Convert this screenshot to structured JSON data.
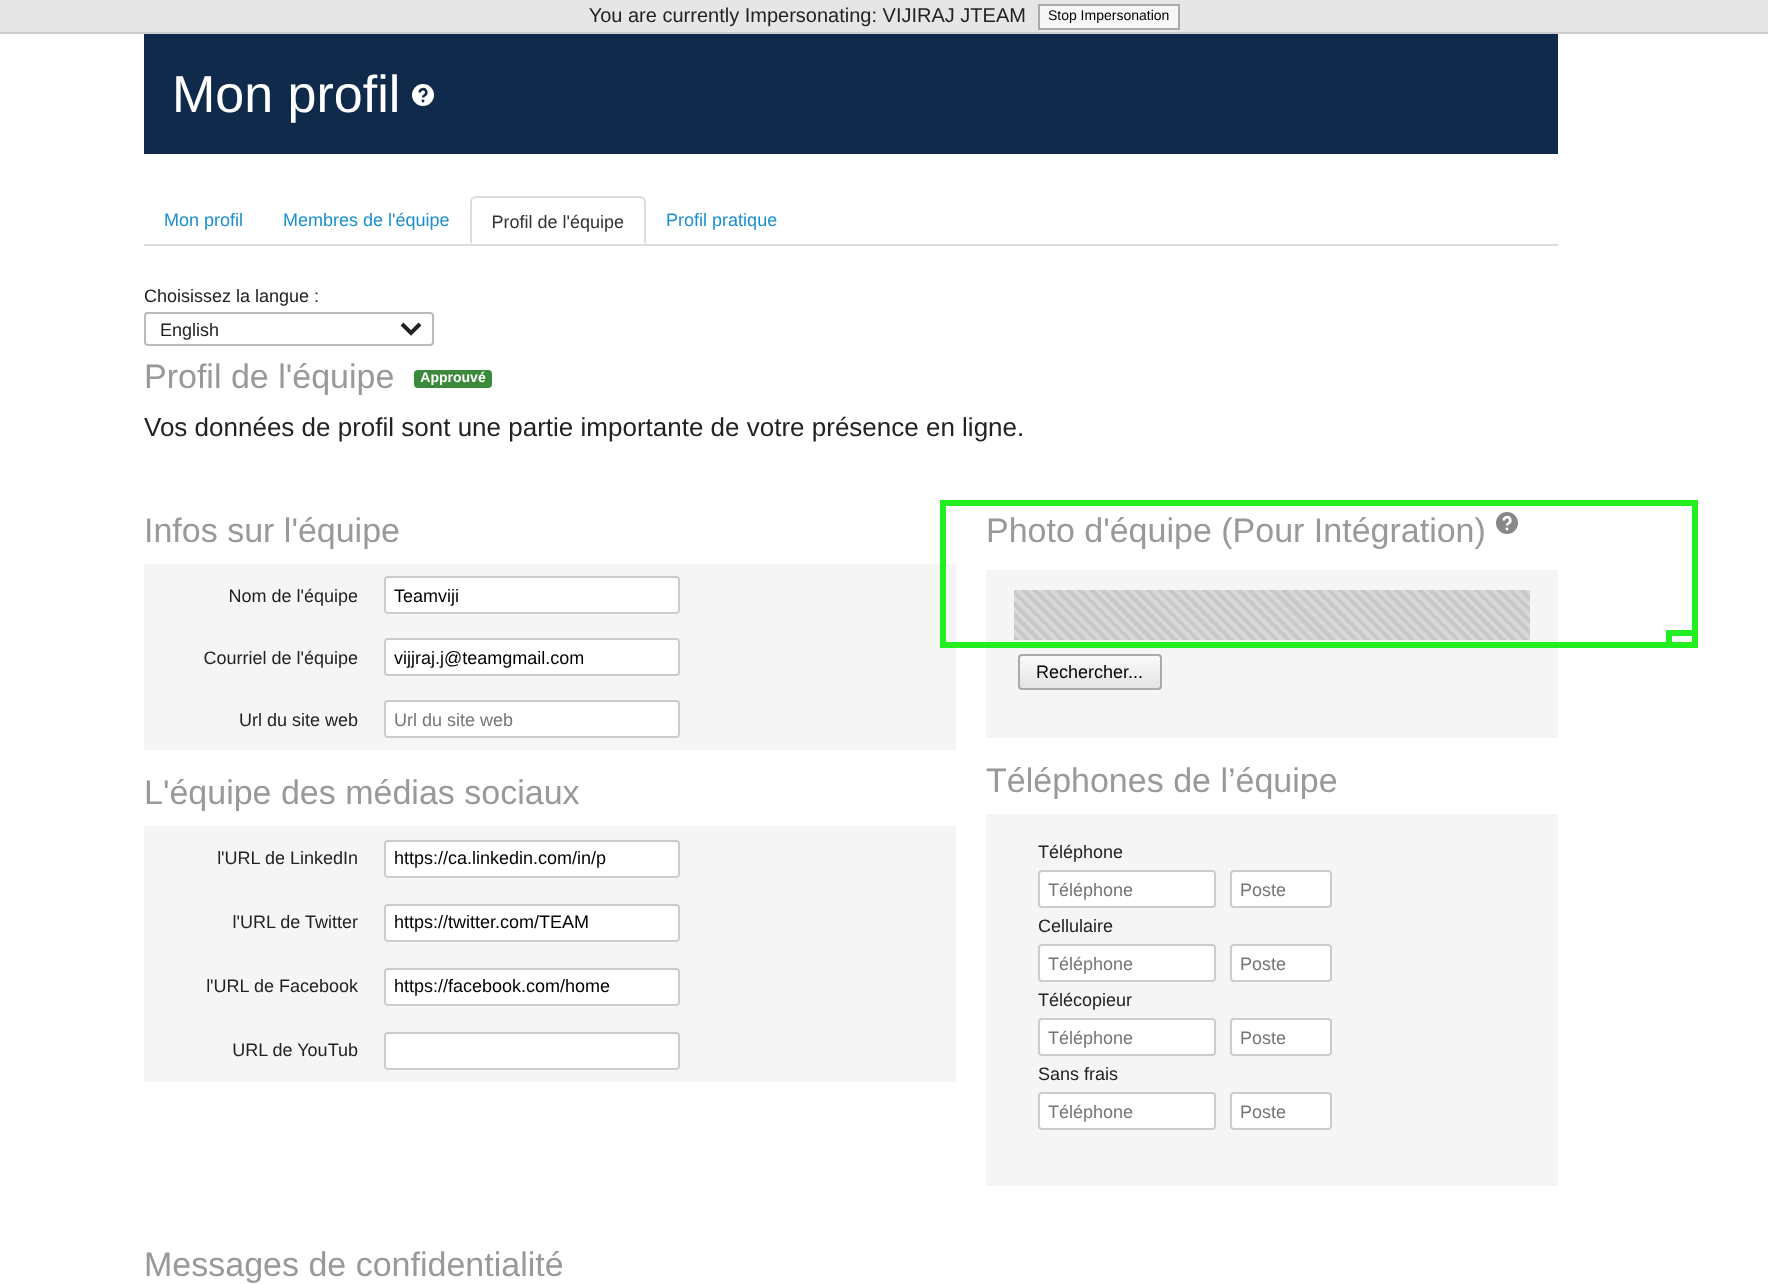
{
  "impersonation_bar": {
    "text": "You are currently Impersonating: VIJIRAJ JTEAM",
    "button": "Stop Impersonation"
  },
  "header": {
    "title": "Mon profil"
  },
  "tabs": [
    {
      "label": "Mon profil",
      "selected": false
    },
    {
      "label": "Membres de l'équipe",
      "selected": false
    },
    {
      "label": "Profil de l'équipe",
      "selected": true
    },
    {
      "label": "Profil pratique",
      "selected": false
    }
  ],
  "language": {
    "label": "Choisissez la langue :",
    "value": "English"
  },
  "profile": {
    "title": "Profil de l'équipe",
    "badge": "Approuvé",
    "description": "Vos données de profil sont une partie importante de votre présence en ligne."
  },
  "team_info": {
    "title": "Infos sur l'équipe",
    "fields": [
      {
        "label": "Nom de l'équipe",
        "value": "Teamviji"
      },
      {
        "label": "Courriel de l'équipe",
        "value": "vijjraj.j@teamgmail.com"
      },
      {
        "label": "Url du site web",
        "placeholder": "Url du site web"
      }
    ]
  },
  "social": {
    "title": "L'équipe des médias sociaux",
    "fields": [
      {
        "label": "l'URL de LinkedIn",
        "value": "https://ca.linkedin.com/in/p"
      },
      {
        "label": "l'URL de Twitter",
        "value": "https://twitter.com/TEAM"
      },
      {
        "label": "l'URL de Facebook",
        "value": "https://facebook.com/home"
      },
      {
        "label": "URL de YouTub"
      }
    ]
  },
  "photo": {
    "title": "Photo d'équipe (Pour Intégration)",
    "button": "Rechercher...",
    "highlighted": true
  },
  "phones": {
    "title": "Téléphones de l’équipe",
    "rows": [
      {
        "label": "Téléphone",
        "phone_placeholder": "Téléphone",
        "ext_placeholder": "Poste"
      },
      {
        "label": "Cellulaire",
        "phone_placeholder": "Téléphone",
        "ext_placeholder": "Poste"
      },
      {
        "label": "Télécopieur",
        "phone_placeholder": "Téléphone",
        "ext_placeholder": "Poste"
      },
      {
        "label": "Sans frais",
        "phone_placeholder": "Téléphone",
        "ext_placeholder": "Poste"
      }
    ]
  },
  "next_section": {
    "title": "Messages de confidentialité"
  }
}
